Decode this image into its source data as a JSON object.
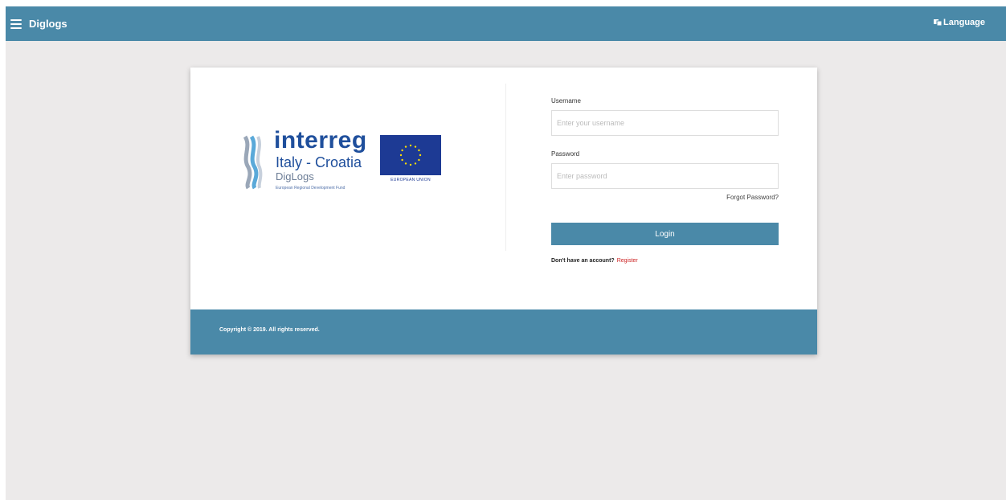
{
  "app": {
    "title": "Diglogs",
    "language_label": "Language"
  },
  "logo": {
    "program": "interreg",
    "region": "Italy - Croatia",
    "project": "DigLogs",
    "fund": "European Regional Development Fund",
    "eu_label": "EUROPEAN UNION"
  },
  "login": {
    "username_label": "Username",
    "username_placeholder": "Enter your username",
    "username_value": "",
    "password_label": "Password",
    "password_placeholder": "Enter password",
    "password_value": "",
    "forgot_label": "Forgot Password?",
    "button_label": "Login",
    "signup_prompt": "Don't have an account?",
    "register_label": "Register"
  },
  "footer": {
    "copyright": "Copyright © 2019. All rights reserved."
  },
  "colors": {
    "primary": "#4a89a8",
    "background": "#eceaea",
    "link_red": "#cc2222",
    "eu_blue": "#1d3a94",
    "eu_star": "#ffdd00"
  }
}
